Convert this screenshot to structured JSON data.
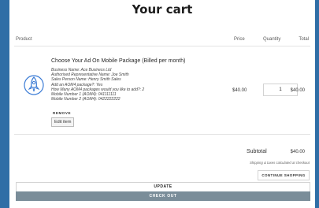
{
  "cart": {
    "title": "Your cart",
    "headers": {
      "product": "Product",
      "price": "Price",
      "quantity": "Quantity",
      "total": "Total"
    },
    "item": {
      "name": "Choose Your Ad On Mobile Package (Billed per month)",
      "details": [
        "Business Name: Ace Business Ltd",
        "Authorised Representative Name: Joe Smith",
        "Sales Person Name: Henry Smith Sales",
        "Add an AOM4 package?: Yes",
        "How Many AOM4 packages would you like to add?: 2",
        "Mobile Number 1 (AOM4): 041111111",
        "Mobile Number 2 (AOM4): 0422222222"
      ],
      "remove_label": "REMOVE",
      "edit_label": "Edit item",
      "price": "$40.00",
      "quantity": "1",
      "total": "$40.00",
      "icon": "rocket-icon"
    },
    "subtotal_label": "Subtotal",
    "subtotal_value": "$40.00",
    "shipping_note": "Shipping & taxes calculated at checkout",
    "continue_label": "CONTINUE SHOPPING",
    "update_label": "UPDATE",
    "checkout_label": "CHECK OUT"
  },
  "colors": {
    "background": "#2f6ea6",
    "checkout": "#7a8d99"
  }
}
